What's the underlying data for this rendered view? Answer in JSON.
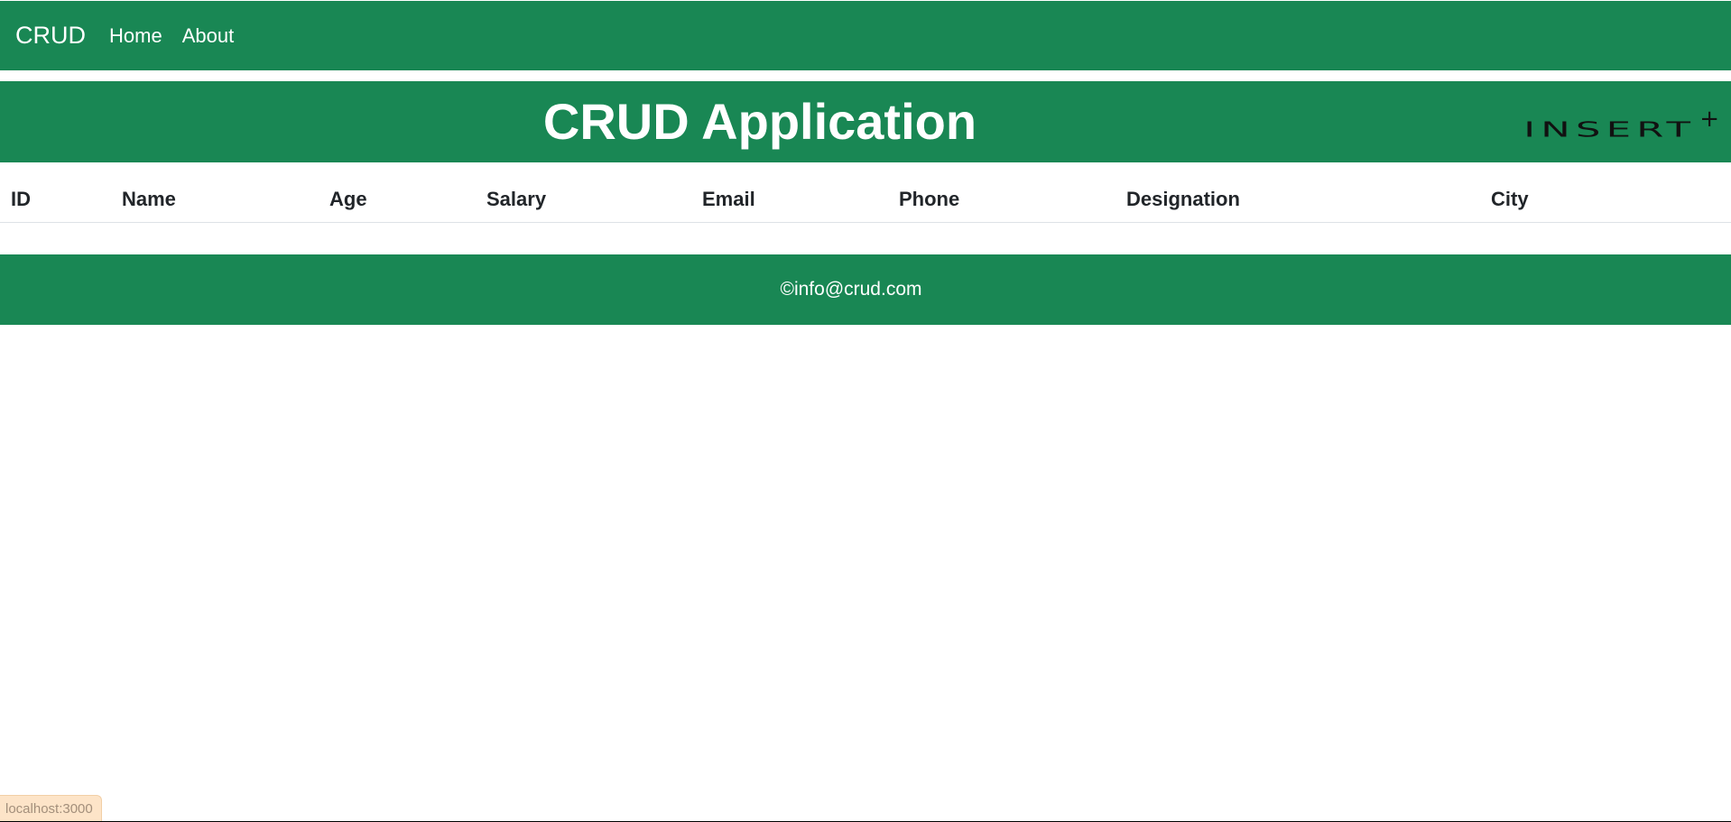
{
  "navbar": {
    "brand": "CRUD",
    "links": [
      {
        "label": "Home"
      },
      {
        "label": "About"
      }
    ]
  },
  "header": {
    "title": "CRUD Application",
    "insert_label": "INSERT",
    "insert_icon": "plus-icon"
  },
  "table": {
    "columns": [
      "ID",
      "Name",
      "Age",
      "Salary",
      "Email",
      "Phone",
      "Designation",
      "City"
    ],
    "rows": []
  },
  "footer": {
    "text": "©info@crud.com"
  },
  "status_bar": {
    "url": "localhost:3000"
  },
  "colors": {
    "primary": "#198754",
    "text_dark": "#212529",
    "text_light": "#ffffff"
  }
}
